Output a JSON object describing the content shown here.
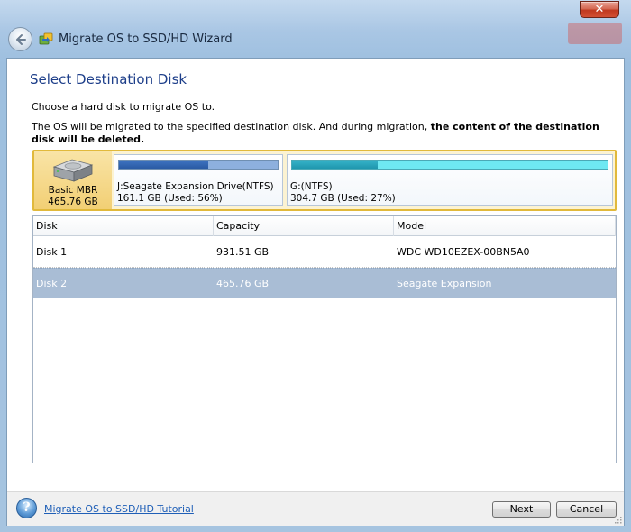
{
  "window": {
    "title": "Migrate OS to SSD/HD Wizard",
    "close_label": "✕"
  },
  "page": {
    "heading": "Select Destination Disk",
    "instruction": "Choose a hard disk to migrate OS to.",
    "warning_prefix": "The OS will be migrated to the specified destination disk. And during migration, ",
    "warning_bold": "the content of the destination disk will be deleted."
  },
  "disk_map": {
    "type": "Basic MBR",
    "size": "465.76 GB",
    "partitions": [
      {
        "label": "J:Seagate Expansion Drive(NTFS)",
        "usage": "161.1 GB (Used: 56%)",
        "used_fraction": 0.56
      },
      {
        "label": "G:(NTFS)",
        "usage": "304.7 GB (Used: 27%)",
        "used_fraction": 0.27
      }
    ]
  },
  "table": {
    "columns": [
      "Disk",
      "Capacity",
      "Model"
    ],
    "rows": [
      {
        "disk": "Disk 1",
        "capacity": "931.51 GB",
        "model": "WDC WD10EZEX-00BN5A0",
        "selected": false
      },
      {
        "disk": "Disk 2",
        "capacity": "465.76 GB",
        "model": "Seagate Expansion",
        "selected": true
      }
    ]
  },
  "footer": {
    "help_glyph": "?",
    "tutorial_link": "Migrate OS to SSD/HD Tutorial",
    "next_label": "Next",
    "cancel_label": "Cancel"
  },
  "colors": {
    "heading": "#1e3f8a",
    "selection": "#a9bdd5",
    "diskmap_border": "#e1b93b",
    "partition1_used": "#2a5aa3",
    "partition2_used": "#1f96ad"
  }
}
